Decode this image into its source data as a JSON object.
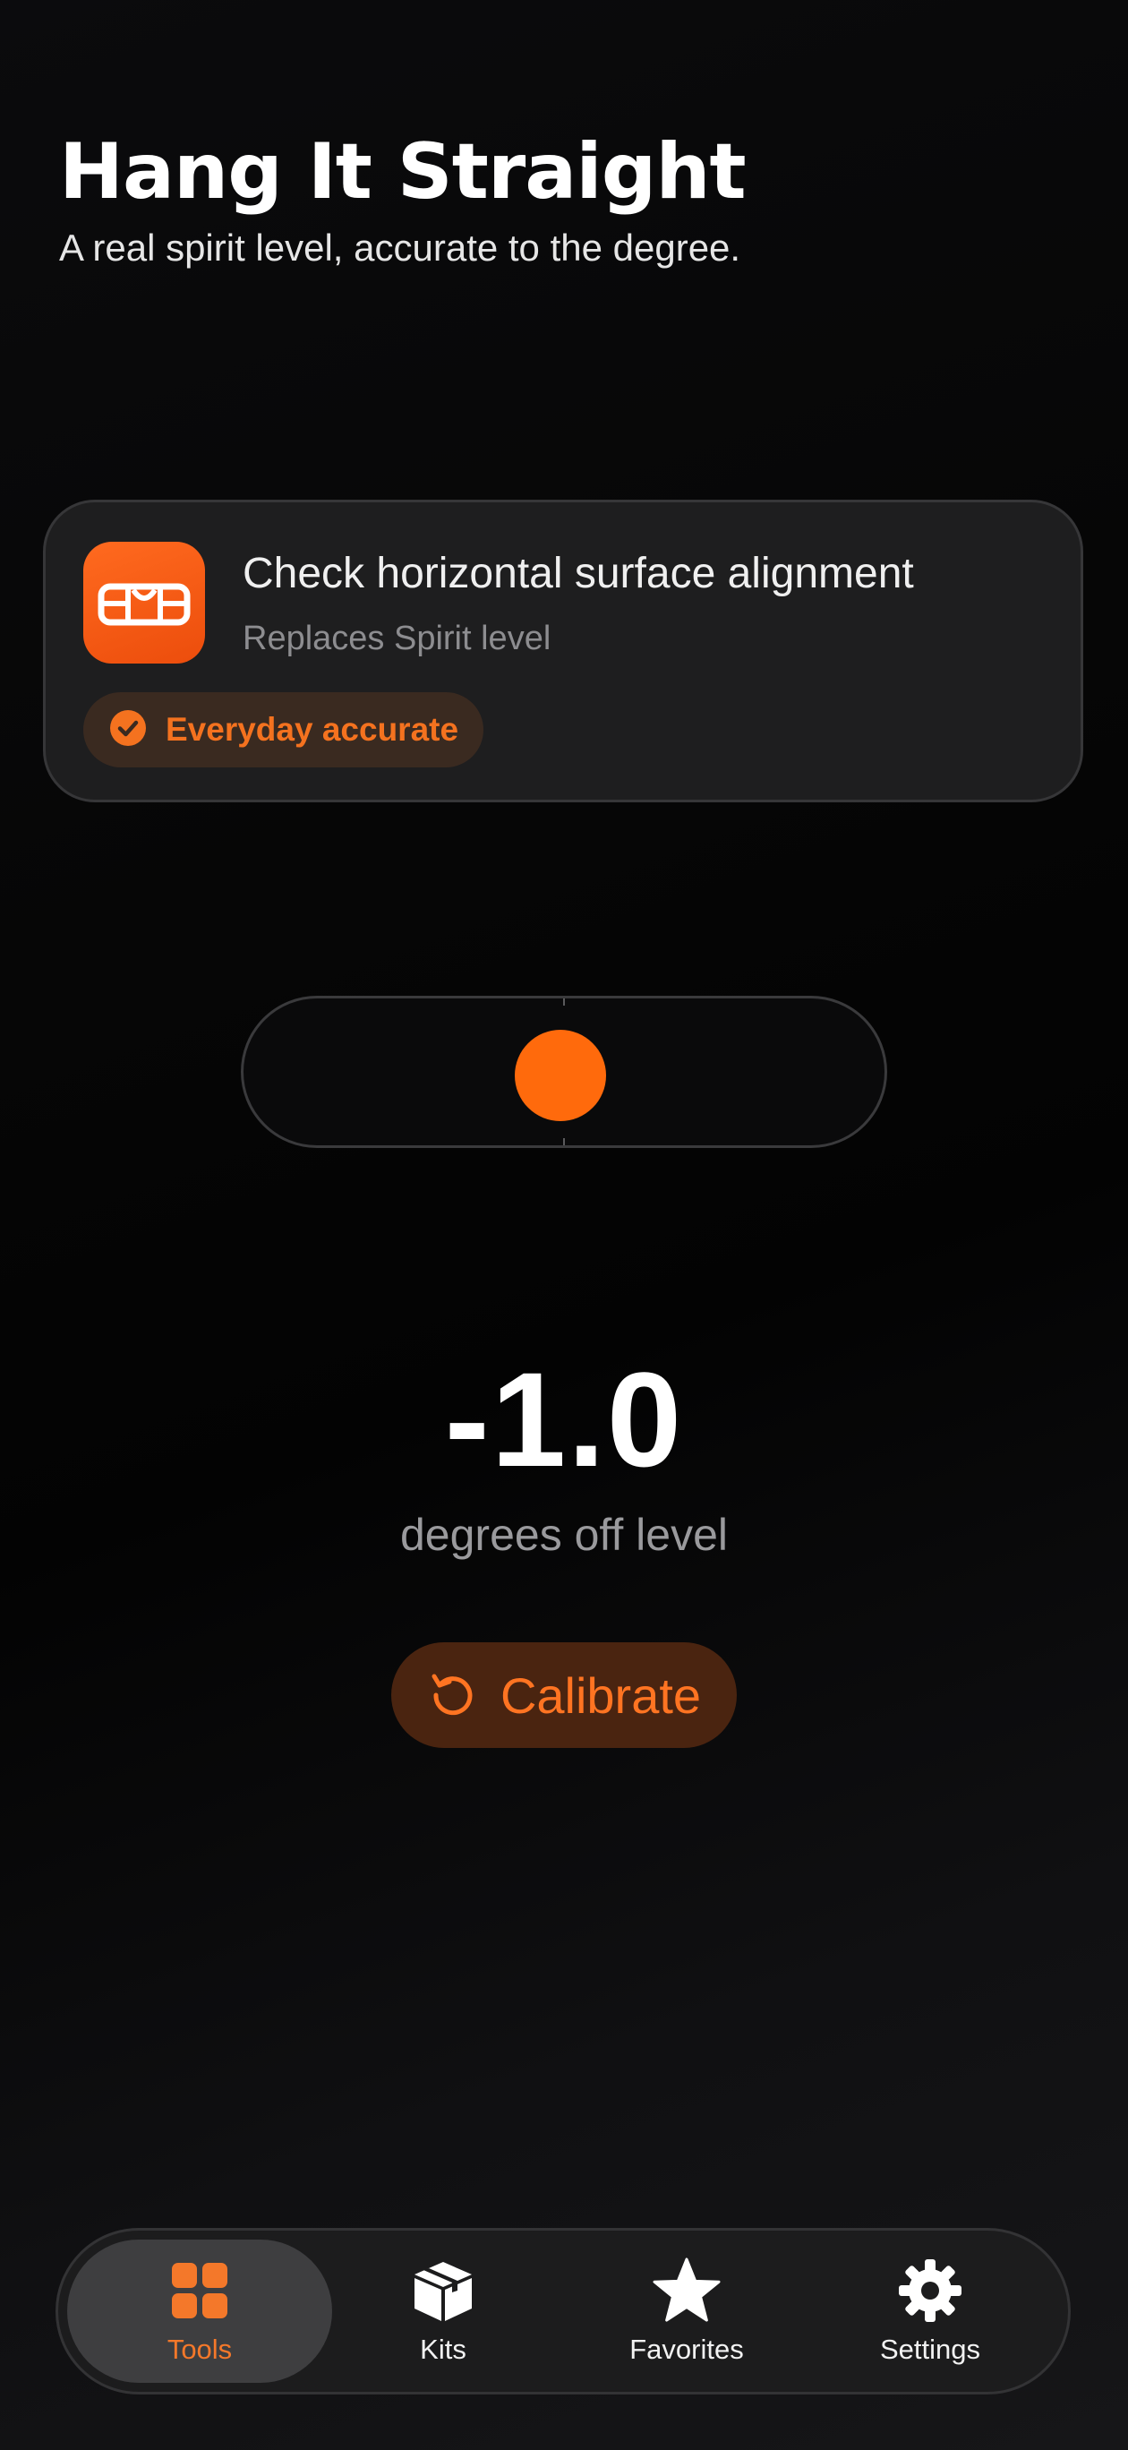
{
  "header": {
    "title": "Hang It Straight",
    "subtitle": "A real spirit level, accurate to the degree."
  },
  "tool_card": {
    "icon": "spirit-level-icon",
    "title": "Check horizontal surface alignment",
    "replaces": "Replaces Spirit level",
    "accuracy_badge": "Everyday accurate",
    "badge_icon": "check-circle-icon"
  },
  "level": {
    "degrees_off": -1.0,
    "reading": "-1.0",
    "unit_label": "degrees off level"
  },
  "calibrate_button": {
    "label": "Calibrate",
    "icon": "rotate-ccw-icon"
  },
  "tabbar": {
    "tabs": [
      {
        "label": "Tools",
        "icon": "grid-icon",
        "active": true
      },
      {
        "label": "Kits",
        "icon": "box-icon",
        "active": false
      },
      {
        "label": "Favorites",
        "icon": "star-icon",
        "active": false
      },
      {
        "label": "Settings",
        "icon": "gear-icon",
        "active": false
      }
    ]
  },
  "colors": {
    "accent": "#ff6a0c",
    "accent_text": "#f4721f",
    "background": "#050505",
    "card": "#1e1e1f"
  }
}
